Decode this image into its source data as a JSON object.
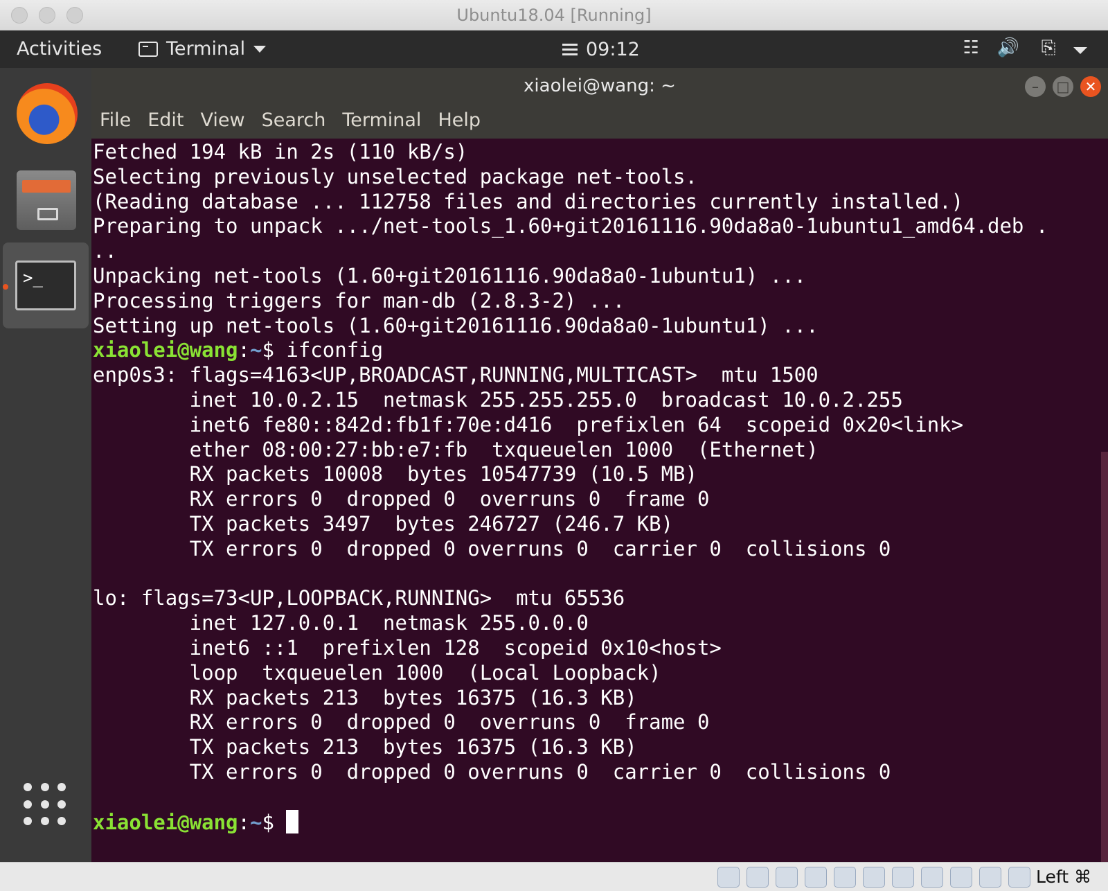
{
  "window": {
    "title": "Ubuntu18.04 [Running]"
  },
  "topbar": {
    "activities": "Activities",
    "app_menu": "Terminal",
    "clock": "09:12"
  },
  "terminal_window": {
    "title": "xiaolei@wang: ~",
    "menu": [
      "File",
      "Edit",
      "View",
      "Search",
      "Terminal",
      "Help"
    ]
  },
  "terminal": {
    "prompt_user": "xiaolei@wang",
    "prompt_path": "~",
    "prompt_suffix": "$",
    "command": "ifconfig",
    "output_before": [
      "Fetched 194 kB in 2s (110 kB/s)",
      "Selecting previously unselected package net-tools.",
      "(Reading database ... 112758 files and directories currently installed.)",
      "Preparing to unpack .../net-tools_1.60+git20161116.90da8a0-1ubuntu1_amd64.deb .",
      "..",
      "Unpacking net-tools (1.60+git20161116.90da8a0-1ubuntu1) ...",
      "Processing triggers for man-db (2.8.3-2) ...",
      "Setting up net-tools (1.60+git20161116.90da8a0-1ubuntu1) ..."
    ],
    "output_after": [
      "enp0s3: flags=4163<UP,BROADCAST,RUNNING,MULTICAST>  mtu 1500",
      "        inet 10.0.2.15  netmask 255.255.255.0  broadcast 10.0.2.255",
      "        inet6 fe80::842d:fb1f:70e:d416  prefixlen 64  scopeid 0x20<link>",
      "        ether 08:00:27:bb:e7:fb  txqueuelen 1000  (Ethernet)",
      "        RX packets 10008  bytes 10547739 (10.5 MB)",
      "        RX errors 0  dropped 0  overruns 0  frame 0",
      "        TX packets 3497  bytes 246727 (246.7 KB)",
      "        TX errors 0  dropped 0 overruns 0  carrier 0  collisions 0",
      "",
      "lo: flags=73<UP,LOOPBACK,RUNNING>  mtu 65536",
      "        inet 127.0.0.1  netmask 255.0.0.0",
      "        inet6 ::1  prefixlen 128  scopeid 0x10<host>",
      "        loop  txqueuelen 1000  (Local Loopback)",
      "        RX packets 213  bytes 16375 (16.3 KB)",
      "        RX errors 0  dropped 0  overruns 0  frame 0",
      "        TX packets 213  bytes 16375 (16.3 KB)",
      "        TX errors 0  dropped 0 overruns 0  carrier 0  collisions 0",
      ""
    ]
  },
  "dock": {
    "items": [
      {
        "icon": "firefox-icon"
      },
      {
        "icon": "files-icon"
      },
      {
        "icon": "terminal-icon",
        "active": true
      }
    ]
  },
  "status_bar": {
    "host_key": "Left ⌘"
  },
  "colors": {
    "terminal_bg": "#300a24",
    "prompt_user": "#8ae234",
    "prompt_path": "#729fcf",
    "accent": "#e95420"
  }
}
